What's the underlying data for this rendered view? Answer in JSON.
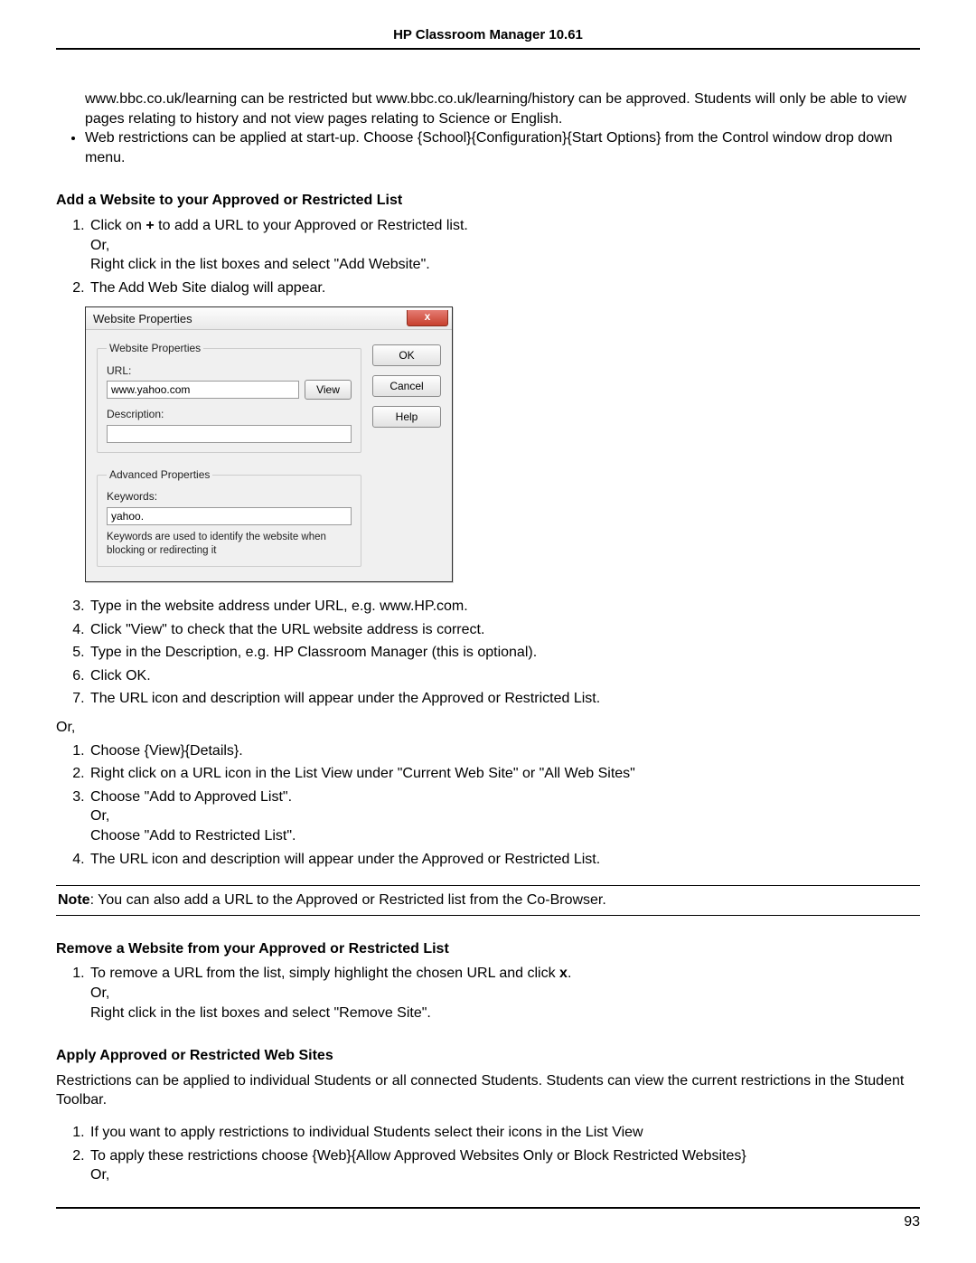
{
  "header": {
    "title": "HP Classroom Manager 10.61"
  },
  "intro": {
    "p1": "www.bbc.co.uk/learning can be restricted but www.bbc.co.uk/learning/history can be approved. Students will only be able to view pages relating to history and not view pages relating to Science or English.",
    "bullet1": "Web restrictions can be applied at start-up. Choose {School}{Configuration}{Start Options} from the Control window drop down menu."
  },
  "section_add": {
    "heading": "Add a Website to your Approved or Restricted List",
    "step1a": "Click on ",
    "step1_plus": "+",
    "step1b": " to add a URL to your Approved or Restricted list.",
    "step1_or": "Or,",
    "step1c": "Right click in the list boxes and select \"Add Website\".",
    "step2": "The Add Web Site dialog will appear.",
    "step3": "Type in the website address under URL, e.g. www.HP.com.",
    "step4": "Click \"View\" to check that the URL website address is correct.",
    "step5": "Type in the Description, e.g. HP Classroom Manager (this is optional).",
    "step6": "Click OK.",
    "step7": "The URL icon and description will appear under the Approved or Restricted List.",
    "or": "Or,",
    "alt1": "Choose {View}{Details}.",
    "alt2": "Right click on a URL icon in the List View under \"Current Web Site\" or \"All Web Sites\"",
    "alt3a": "Choose \"Add to Approved List\".",
    "alt3_or": "Or,",
    "alt3b": "Choose \"Add to Restricted List\".",
    "alt4": "The URL icon and description will appear under the Approved or Restricted List."
  },
  "dialog": {
    "title": "Website Properties",
    "group1": "Website Properties",
    "url_label": "URL:",
    "url_value": "www.yahoo.com",
    "view_btn": "View",
    "desc_label": "Description:",
    "desc_value": "",
    "group2": "Advanced Properties",
    "keywords_label": "Keywords:",
    "keywords_value": "yahoo.",
    "hint": "Keywords are used to identify the website when blocking or redirecting it",
    "ok": "OK",
    "cancel": "Cancel",
    "help": "Help",
    "close_x": "x"
  },
  "note": {
    "label": "Note",
    "text": ": You can also add a URL to the Approved or Restricted list from the Co-Browser."
  },
  "section_remove": {
    "heading": "Remove a Website from your Approved or Restricted List",
    "step1a": "To remove a URL from the list, simply highlight the chosen URL and click ",
    "step1_x": "x",
    "step1b": ".",
    "step1_or": "Or,",
    "step1c": "Right click in the list boxes and select \"Remove Site\"."
  },
  "section_apply": {
    "heading": "Apply Approved or Restricted Web Sites",
    "intro": "Restrictions can be applied to individual Students or all connected Students. Students can view the current restrictions in the Student Toolbar.",
    "step1": "If you want to apply restrictions to individual Students select their icons in the List View",
    "step2a": "To apply these restrictions choose {Web}{Allow Approved Websites Only or Block Restricted Websites}",
    "step2_or": "Or,"
  },
  "footer": {
    "pagenum": "93"
  }
}
